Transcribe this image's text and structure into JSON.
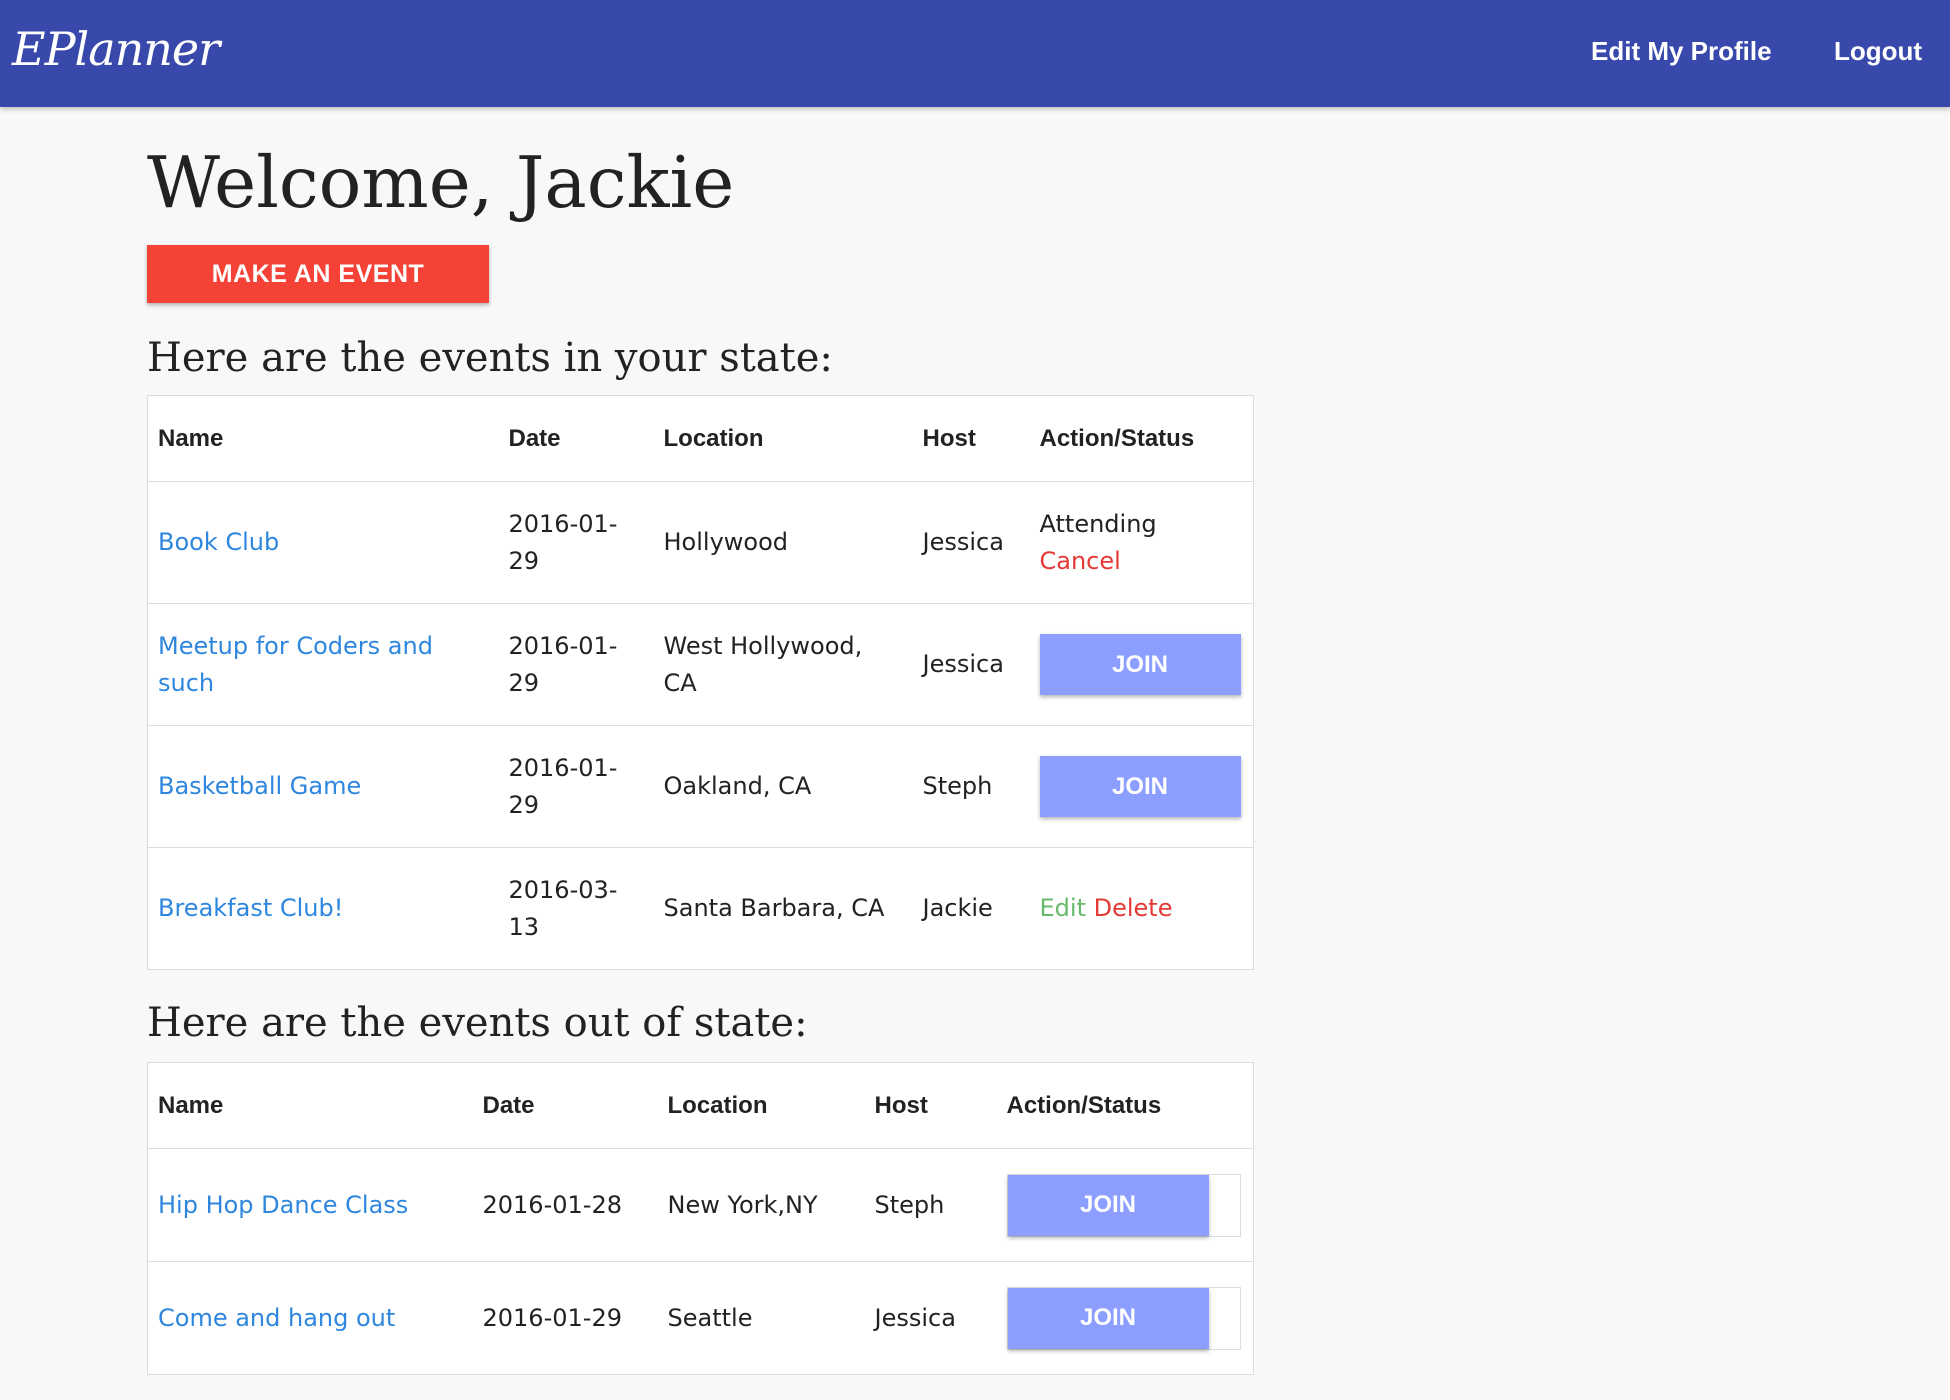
{
  "nav": {
    "brand": "EPlanner",
    "edit_profile": "Edit My Profile",
    "logout": "Logout"
  },
  "welcome": "Welcome, Jackie",
  "make_event_label": "MAKE AN EVENT",
  "in_state": {
    "title": "Here are the events in your state:",
    "headers": [
      "Name",
      "Date",
      "Location",
      "Host",
      "Action/Status"
    ],
    "rows": [
      {
        "name": "Book Club",
        "date": "2016-01-29",
        "location": "Hollywood",
        "host": "Jessica",
        "status": "Attending",
        "action": "Cancel"
      },
      {
        "name": "Meetup for Coders and such",
        "date": "2016-01-29",
        "location": "West Hollywood, CA",
        "host": "Jessica",
        "action": "JOIN"
      },
      {
        "name": "Basketball Game",
        "date": "2016-01-29",
        "location": "Oakland, CA",
        "host": "Steph",
        "action": "JOIN"
      },
      {
        "name": "Breakfast Club!",
        "date": "2016-03-13",
        "location": "Santa Barbara, CA",
        "host": "Jackie",
        "edit": "Edit",
        "delete": "Delete"
      }
    ]
  },
  "out_state": {
    "title": "Here are the events out of state:",
    "headers": [
      "Name",
      "Date",
      "Location",
      "Host",
      "Action/Status"
    ],
    "rows": [
      {
        "name": "Hip Hop Dance Class",
        "date": "2016-01-28",
        "location": "New York,NY",
        "host": "Steph",
        "action": "JOIN"
      },
      {
        "name": "Come and hang out",
        "date": "2016-01-29",
        "location": "Seattle",
        "host": "Jessica",
        "action": "JOIN"
      }
    ]
  },
  "colors": {
    "navbar": "#3949ab",
    "make_button": "#f44336",
    "join_button": "#8c9eff",
    "link": "#2e86de",
    "danger": "#e53935",
    "edit": "#66bb6a"
  }
}
